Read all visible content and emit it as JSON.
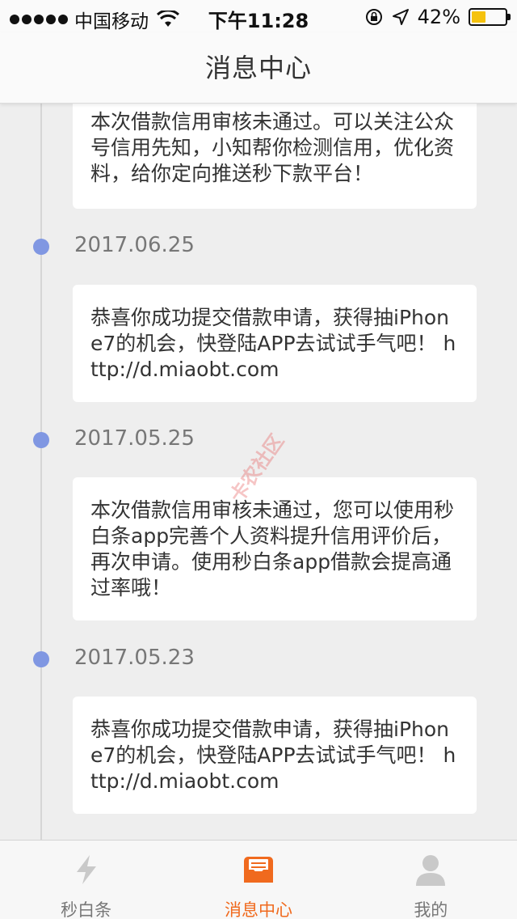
{
  "status_bar": {
    "carrier": "中国移动",
    "time": "下午11:28",
    "battery": "42%",
    "battery_level": 0.42,
    "icons": [
      "signal-dots-icon",
      "wifi-icon",
      "orientation-lock-icon",
      "location-arrow-icon",
      "battery-icon"
    ]
  },
  "nav": {
    "title": "消息中心"
  },
  "messages": [
    {
      "date": "",
      "text": "本次借款信用审核未通过。可以关注公众号信用先知，小知帮你检测信用，优化资料，给你定向推送秒下款平台！"
    },
    {
      "date": "2017.06.25",
      "text": "恭喜你成功提交借款申请，获得抽iPhone7的机会，快登陆APP去试试手气吧！ http://d.miaobt.com"
    },
    {
      "date": "2017.05.25",
      "text": "本次借款信用审核未通过，您可以使用秒白条app完善个人资料提升信用评价后，再次申请。使用秒白条app借款会提高通过率哦！"
    },
    {
      "date": "2017.05.23",
      "text": "恭喜你成功提交借款申请，获得抽iPhone7的机会，快登陆APP去试试手气吧！ http://d.miaobt.com"
    }
  ],
  "watermark": "卡农社区",
  "tabs": [
    {
      "label": "秒白条",
      "icon": "lightning-icon",
      "active": false
    },
    {
      "label": "消息中心",
      "icon": "message-inbox-icon",
      "active": true
    },
    {
      "label": "我的",
      "icon": "user-profile-icon",
      "active": false
    }
  ],
  "colors": {
    "accent": "#f06a1e",
    "timeline_dot": "#8097e2",
    "background": "#eeeeee",
    "battery": "#f5c20e"
  }
}
